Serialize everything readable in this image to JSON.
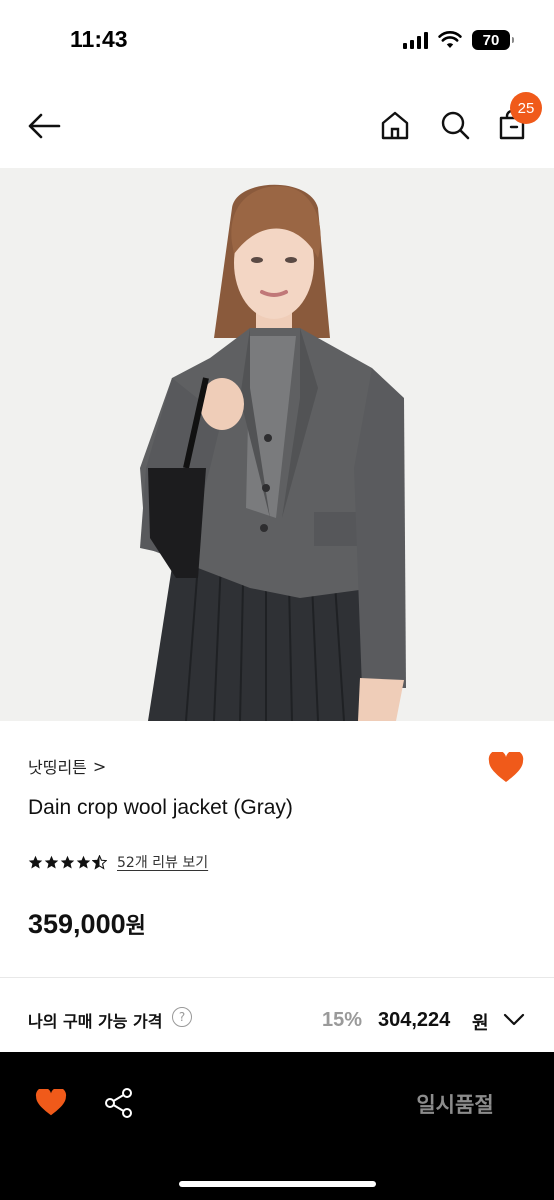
{
  "status_bar": {
    "time": "11:43",
    "battery": "70",
    "icons": [
      "signal-icon",
      "wifi-icon",
      "battery-icon"
    ]
  },
  "nav": {
    "icons": [
      "back-arrow-icon",
      "home-icon",
      "search-icon",
      "shopping-bag-icon"
    ],
    "cart_count": "25"
  },
  "product": {
    "brand": "낫띵리튼",
    "brand_chevron": ">",
    "title": "Dain crop wool jacket (Gray)",
    "rating": 4.5,
    "rating_max": 5,
    "review_link": "52개 리뷰 보기",
    "price_amount": "359,000",
    "price_unit": "원",
    "wishlisted": true
  },
  "my_price": {
    "label": "나의 구매 가능 가격",
    "help": "?",
    "discount_rate": "15%",
    "final_amount": "304,224",
    "final_unit": "원"
  },
  "bottom_bar": {
    "soldout_label": "일시품절",
    "icons": [
      "heart-icon",
      "share-icon"
    ]
  },
  "colors": {
    "accent": "#f05a1a",
    "bottom_bar": "#000000",
    "muted_text": "#9a9a9a"
  }
}
